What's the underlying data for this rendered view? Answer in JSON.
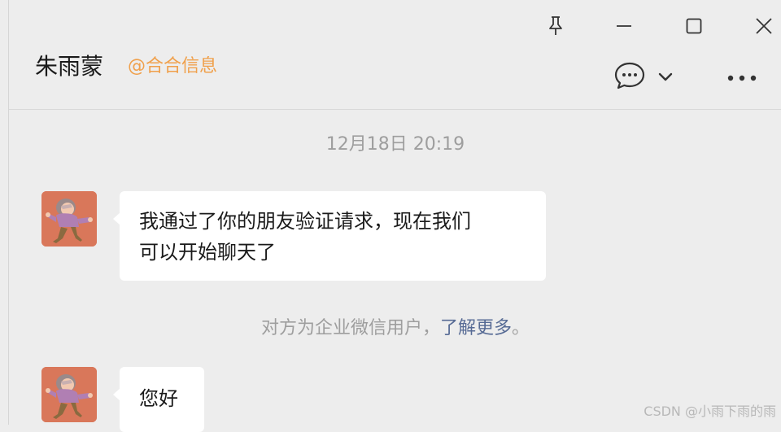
{
  "header": {
    "contact_name": "朱雨蒙",
    "org_tag": "@合合信息"
  },
  "icons": {
    "pin": "pin-icon",
    "minimize": "minimize-icon",
    "maximize": "maximize-icon",
    "close": "close-icon",
    "chat": "chat-bubble-icon",
    "chevron": "chevron-down-icon",
    "more": "more-dots-icon"
  },
  "chat": {
    "timestamp": "12月18日 20:19",
    "messages": [
      {
        "sender": "contact",
        "lines": [
          "我通过了你的朋友验证请求，现在我们",
          "可以开始聊天了"
        ]
      },
      {
        "sender": "contact",
        "lines": [
          "您好"
        ]
      }
    ],
    "notice": {
      "text": "对方为企业微信用户，",
      "link": "了解更多",
      "suffix": "。"
    }
  },
  "watermark": "CSDN @小雨下雨的雨",
  "colors": {
    "background": "#ededed",
    "bubble": "#ffffff",
    "org_tag": "#f0a04b",
    "link": "#576b95",
    "muted_text": "#9e9e9e",
    "avatar_bg": "#d9775a"
  }
}
